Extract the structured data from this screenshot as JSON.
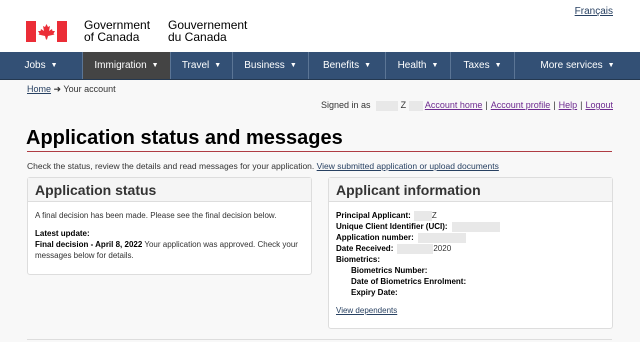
{
  "header": {
    "language_link": "Français",
    "wordmark_en_line1": "Government",
    "wordmark_en_line2": "of Canada",
    "wordmark_fr_line1": "Gouvernement",
    "wordmark_fr_line2": "du Canada",
    "flag_color": "#eb2d37"
  },
  "nav": {
    "items": [
      {
        "label": "Jobs",
        "active": false
      },
      {
        "label": "Immigration",
        "active": true
      },
      {
        "label": "Travel",
        "active": false
      },
      {
        "label": "Business",
        "active": false
      },
      {
        "label": "Benefits",
        "active": false
      },
      {
        "label": "Health",
        "active": false
      },
      {
        "label": "Taxes",
        "active": false
      },
      {
        "label": "More services",
        "active": false
      }
    ]
  },
  "breadcrumb": {
    "home": "Home",
    "current": "Your account"
  },
  "account": {
    "signed_in_prefix": "Signed in as",
    "signed_in_suffix": "Z",
    "links": [
      "Account home",
      "Account profile",
      "Help",
      "Logout"
    ]
  },
  "page": {
    "title": "Application status and messages",
    "intro_text": "Check the status, review the details and read messages for your application.",
    "intro_link": "View submitted application or upload documents"
  },
  "status_panel": {
    "heading": "Application status",
    "decision_text": "A final decision has been made. Please see the final decision below.",
    "latest_update_label": "Latest update:",
    "final_decision_label": "Final decision - April 8, 2022",
    "final_decision_text": " Your application was approved. Check your messages below for details."
  },
  "applicant_panel": {
    "heading": "Applicant information",
    "principal_label": "Principal Applicant:",
    "principal_value": "Z",
    "uci_label": "Unique Client Identifier (UCI):",
    "app_number_label": "Application number:",
    "date_received_label": "Date Received:",
    "date_received_value": "2020",
    "biometrics_label": "Biometrics:",
    "bio_number_label": "Biometrics Number:",
    "bio_date_label": "Date of Biometrics Enrolment:",
    "expiry_label": "Expiry Date:",
    "dependents_link": "View dependents"
  }
}
